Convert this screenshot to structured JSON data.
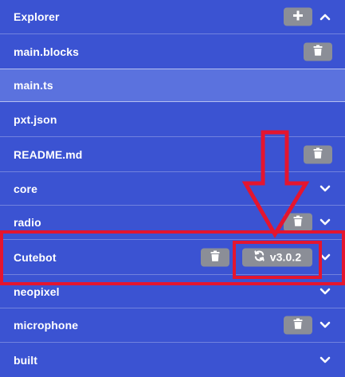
{
  "explorer": {
    "title": "Explorer",
    "header_icons": {
      "add": "plus-icon",
      "collapse": "chevron-up-icon"
    },
    "items": [
      {
        "label": "main.blocks",
        "has_delete": true
      },
      {
        "label": "main.ts",
        "selected": true
      },
      {
        "label": "pxt.json"
      },
      {
        "label": "README.md",
        "has_delete": true
      },
      {
        "label": "core",
        "expand": "chevron-down-icon"
      },
      {
        "label": "radio",
        "has_delete": true,
        "expand": "chevron-down-icon"
      },
      {
        "label": "Cutebot",
        "has_delete": true,
        "version": "v3.0.2",
        "version_icon": "refresh-icon",
        "expand": "chevron-down-icon"
      },
      {
        "label": "neopixel",
        "expand": "chevron-down-icon"
      },
      {
        "label": "microphone",
        "has_delete": true,
        "expand": "chevron-down-icon"
      },
      {
        "label": "built",
        "expand": "chevron-down-icon"
      }
    ]
  },
  "colors": {
    "background": "#3b53d2",
    "selected_row": "#5b72de",
    "button": "#8b8e97",
    "annotation": "#e4152f",
    "text": "#ffffff"
  }
}
